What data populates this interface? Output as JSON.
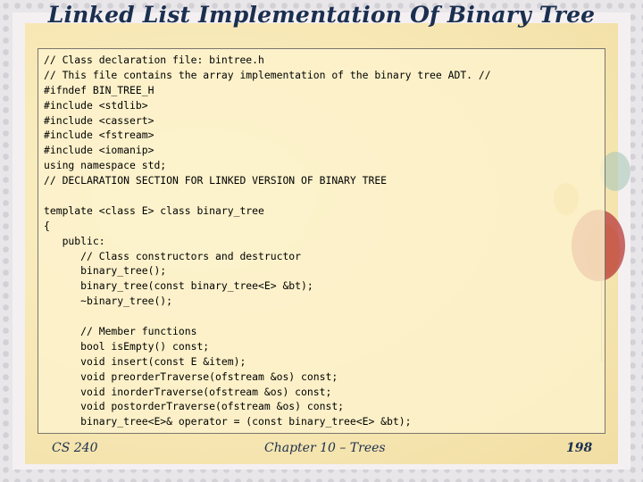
{
  "slide": {
    "title": "Linked List Implementation Of Binary Tree",
    "code_lines": [
      "// Class declaration file: bintree.h",
      "// This file contains the array implementation of the binary tree ADT. //",
      "#ifndef BIN_TREE_H",
      "#include <stdlib>",
      "#include <cassert>",
      "#include <fstream>",
      "#include <iomanip>",
      "using namespace std;",
      "// DECLARATION SECTION FOR LINKED VERSION OF BINARY TREE",
      "",
      "template <class E> class binary_tree",
      "{",
      "   public:",
      "      // Class constructors and destructor",
      "      binary_tree();",
      "      binary_tree(const binary_tree<E> &bt);",
      "      ~binary_tree();",
      "",
      "      // Member functions",
      "      bool isEmpty() const;",
      "      void insert(const E &item);",
      "      void preorderTraverse(ofstream &os) const;",
      "      void inorderTraverse(ofstream &os) const;",
      "      void postorderTraverse(ofstream &os) const;",
      "      binary_tree<E>& operator = (const binary_tree<E> &bt);"
    ],
    "footer": {
      "course": "CS 240",
      "chapter": "Chapter 10 – Trees",
      "page": "198"
    }
  }
}
